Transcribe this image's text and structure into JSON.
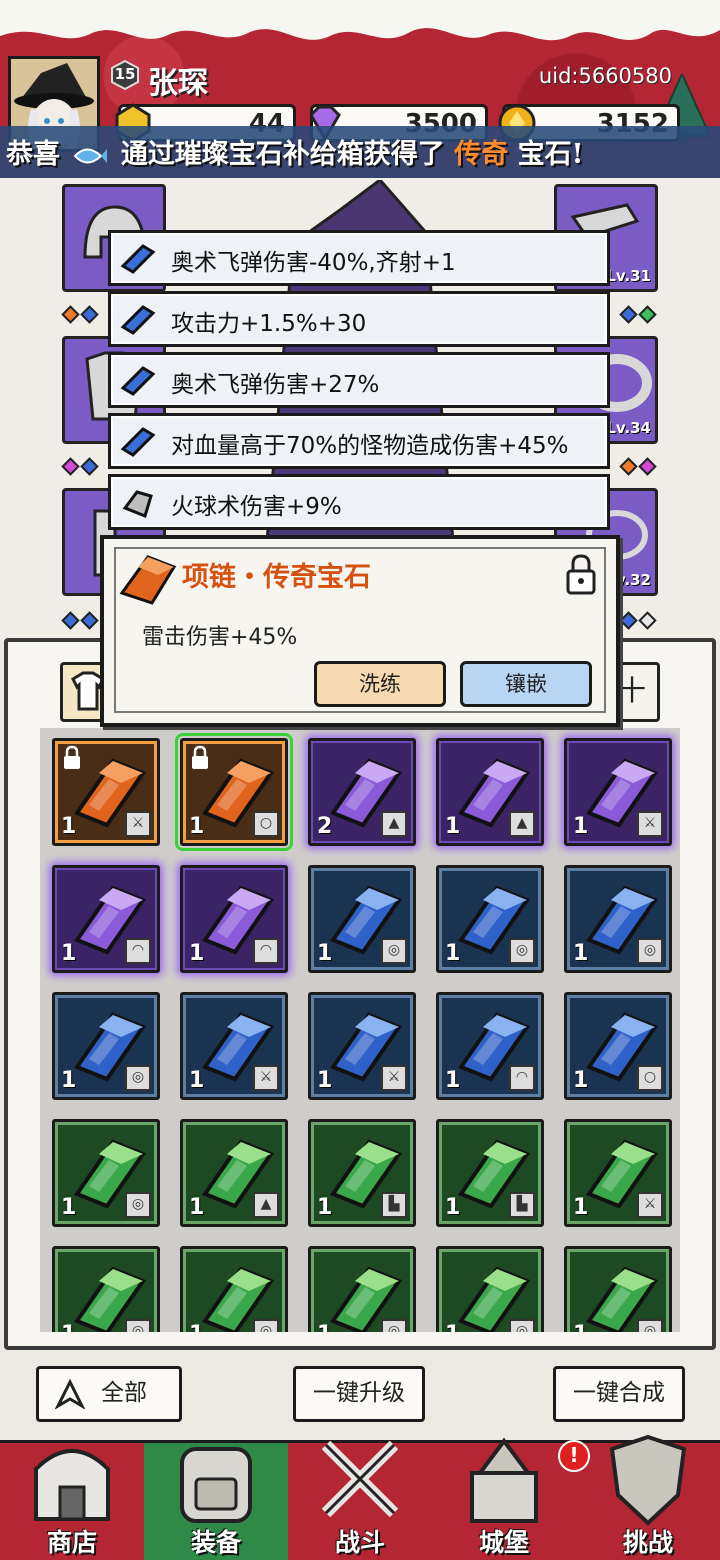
{
  "player": {
    "level": "15",
    "name": "张琛",
    "uid": "uid:5660580"
  },
  "currencies": [
    {
      "icon": "gold-coin-icon",
      "value": "44"
    },
    {
      "icon": "diamond-icon",
      "value": "3500"
    },
    {
      "icon": "gold-gem-icon",
      "value": "3152"
    }
  ],
  "announcement": {
    "prefix": "恭喜",
    "middle": "通过璀璨宝石补给箱获得了",
    "highlight": "传奇",
    "suffix": "宝石!"
  },
  "equipment_slots": [
    {
      "level": "Lv.31"
    },
    {
      "level": "Lv.34"
    },
    {
      "level": "Lv.32"
    }
  ],
  "affixes": [
    {
      "text": "奥术飞弹伤害-40%,齐射+1",
      "gem": "blue"
    },
    {
      "text": "攻击力+1.5%+30",
      "gem": "blue"
    },
    {
      "text": "奥术飞弹伤害+27%",
      "gem": "blue"
    },
    {
      "text": "对血量高于70%的怪物造成伤害+45%",
      "gem": "blue"
    },
    {
      "text": "火球术伤害+9%",
      "gem": "grey"
    }
  ],
  "gem_popup": {
    "title": "项链・传奇宝石",
    "effect": "雷击伤害+45%",
    "refine_label": "洗练",
    "inlay_label": "镶嵌"
  },
  "inventory": [
    {
      "rarity": "orange",
      "qty": "1",
      "slot": "weapon",
      "locked": true
    },
    {
      "rarity": "orange",
      "qty": "1",
      "slot": "necklace",
      "locked": true,
      "selected": true
    },
    {
      "rarity": "purple",
      "qty": "2",
      "slot": "armor"
    },
    {
      "rarity": "purple",
      "qty": "1",
      "slot": "armor"
    },
    {
      "rarity": "purple",
      "qty": "1",
      "slot": "weapon"
    },
    {
      "rarity": "purple",
      "qty": "1",
      "slot": "helmet"
    },
    {
      "rarity": "purple",
      "qty": "1",
      "slot": "helmet"
    },
    {
      "rarity": "blue",
      "qty": "1",
      "slot": "ring"
    },
    {
      "rarity": "blue",
      "qty": "1",
      "slot": "ring"
    },
    {
      "rarity": "blue",
      "qty": "1",
      "slot": "ring"
    },
    {
      "rarity": "blue",
      "qty": "1",
      "slot": "ring"
    },
    {
      "rarity": "blue",
      "qty": "1",
      "slot": "weapon"
    },
    {
      "rarity": "blue",
      "qty": "1",
      "slot": "weapon"
    },
    {
      "rarity": "blue",
      "qty": "1",
      "slot": "helmet"
    },
    {
      "rarity": "blue",
      "qty": "1",
      "slot": "necklace"
    },
    {
      "rarity": "green",
      "qty": "1",
      "slot": "ring"
    },
    {
      "rarity": "green",
      "qty": "1",
      "slot": "armor"
    },
    {
      "rarity": "green",
      "qty": "1",
      "slot": "boots"
    },
    {
      "rarity": "green",
      "qty": "1",
      "slot": "boots"
    },
    {
      "rarity": "green",
      "qty": "1",
      "slot": "weapon"
    },
    {
      "rarity": "green",
      "qty": "1",
      "slot": "ring"
    },
    {
      "rarity": "green",
      "qty": "1",
      "slot": "ring"
    },
    {
      "rarity": "green",
      "qty": "1",
      "slot": "ring"
    },
    {
      "rarity": "green",
      "qty": "1",
      "slot": "ring"
    },
    {
      "rarity": "green",
      "qty": "1",
      "slot": "ring"
    }
  ],
  "actions": {
    "all": "全部",
    "upgrade": "一键升级",
    "merge": "一键合成"
  },
  "nav": [
    {
      "label": "商店",
      "icon": "shop-icon"
    },
    {
      "label": "装备",
      "icon": "backpack-icon",
      "active": true
    },
    {
      "label": "战斗",
      "icon": "crossed-swords-icon"
    },
    {
      "label": "城堡",
      "icon": "castle-icon",
      "badge": "!"
    },
    {
      "label": "挑战",
      "icon": "shield-icon"
    }
  ],
  "colors": {
    "header_red": "#b42634",
    "legend_orange": "#d6500e",
    "active_tab_green": "#2f8a48"
  }
}
